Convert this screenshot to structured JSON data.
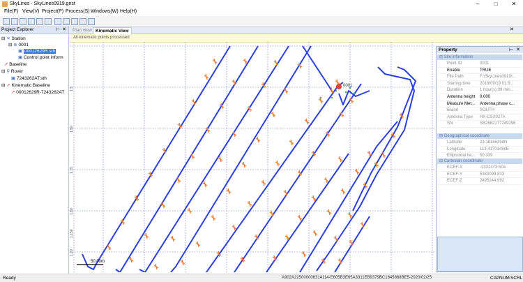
{
  "window": {
    "title": "SkyLines - SkyLines0919.gnst",
    "colors": {
      "accent": "#3373d6",
      "track": "#2b3fe0",
      "point": "#f07a2a"
    }
  },
  "menu": [
    "File(F)",
    "View(V)",
    "Project(P)",
    "Process(S)",
    "Windows(W)",
    "Help(H)"
  ],
  "explorer": {
    "title": "Project Explorer",
    "items": {
      "station": "Station",
      "station_id": "0001",
      "station_file": "00012629R.sth",
      "control_point": "Control point inform",
      "baseline": "Baseline",
      "rover": "Rover",
      "rover_file": "7243262AT.sth",
      "kinematic_baseline": "Kinematic Baseline",
      "kinematic_item": "00012629R-7243262AT"
    }
  },
  "tabs": {
    "plan": "Plan view",
    "kinematic": "Kinematic View"
  },
  "info": {
    "message": "All kinematic points processed"
  },
  "map": {
    "ticks": [
      "1.5",
      "1.50",
      "1.75",
      "1.80",
      "1.150",
      "1.20"
    ],
    "station_label": "0001",
    "scale": "50.00m"
  },
  "property": {
    "title": "Property",
    "sections": {
      "site": "Site information",
      "geo": "Geographical coordinate",
      "cart": "Cartesian coordinate"
    },
    "site_rows": [
      {
        "k": "Point ID",
        "v": "0001"
      },
      {
        "k": "Enable",
        "v": "TRUE"
      },
      {
        "k": "File Path",
        "v": "F:\\SkyLines0919\\..."
      },
      {
        "k": "Starting time",
        "v": "2018/09/19 01:5..."
      },
      {
        "k": "Duration",
        "v": "1 hour(s) 39 min..."
      },
      {
        "k": "Antenna height",
        "v": "0.000"
      },
      {
        "k": "Measure Met...",
        "v": "Antenna phase c..."
      },
      {
        "k": "Brand",
        "v": "SOUTH"
      },
      {
        "k": "Antenna Type",
        "v": "HX-CSX027A"
      },
      {
        "k": "SN",
        "v": "SB2682177249296"
      }
    ],
    "geo_rows": [
      {
        "k": "Latitude",
        "v": "23.1816535dN"
      },
      {
        "k": "Longitude",
        "v": "113.4170148dE"
      },
      {
        "k": "Ellipsoidal he...",
        "v": "50.339"
      }
    ],
    "cart_rows": [
      {
        "k": "ECEF-X",
        "v": "-2331373.504"
      },
      {
        "k": "ECEF-Y",
        "v": "5383099.833"
      },
      {
        "k": "ECEF-Z",
        "v": "2495244.692"
      }
    ]
  },
  "status": {
    "left": "Ready",
    "license": "A902A225000006314114-E605B3E65A3311EB9379BC1645868BE5-2020/02/25",
    "caps": "CAP",
    "num": "NUM",
    "scrl": "SCRL"
  }
}
